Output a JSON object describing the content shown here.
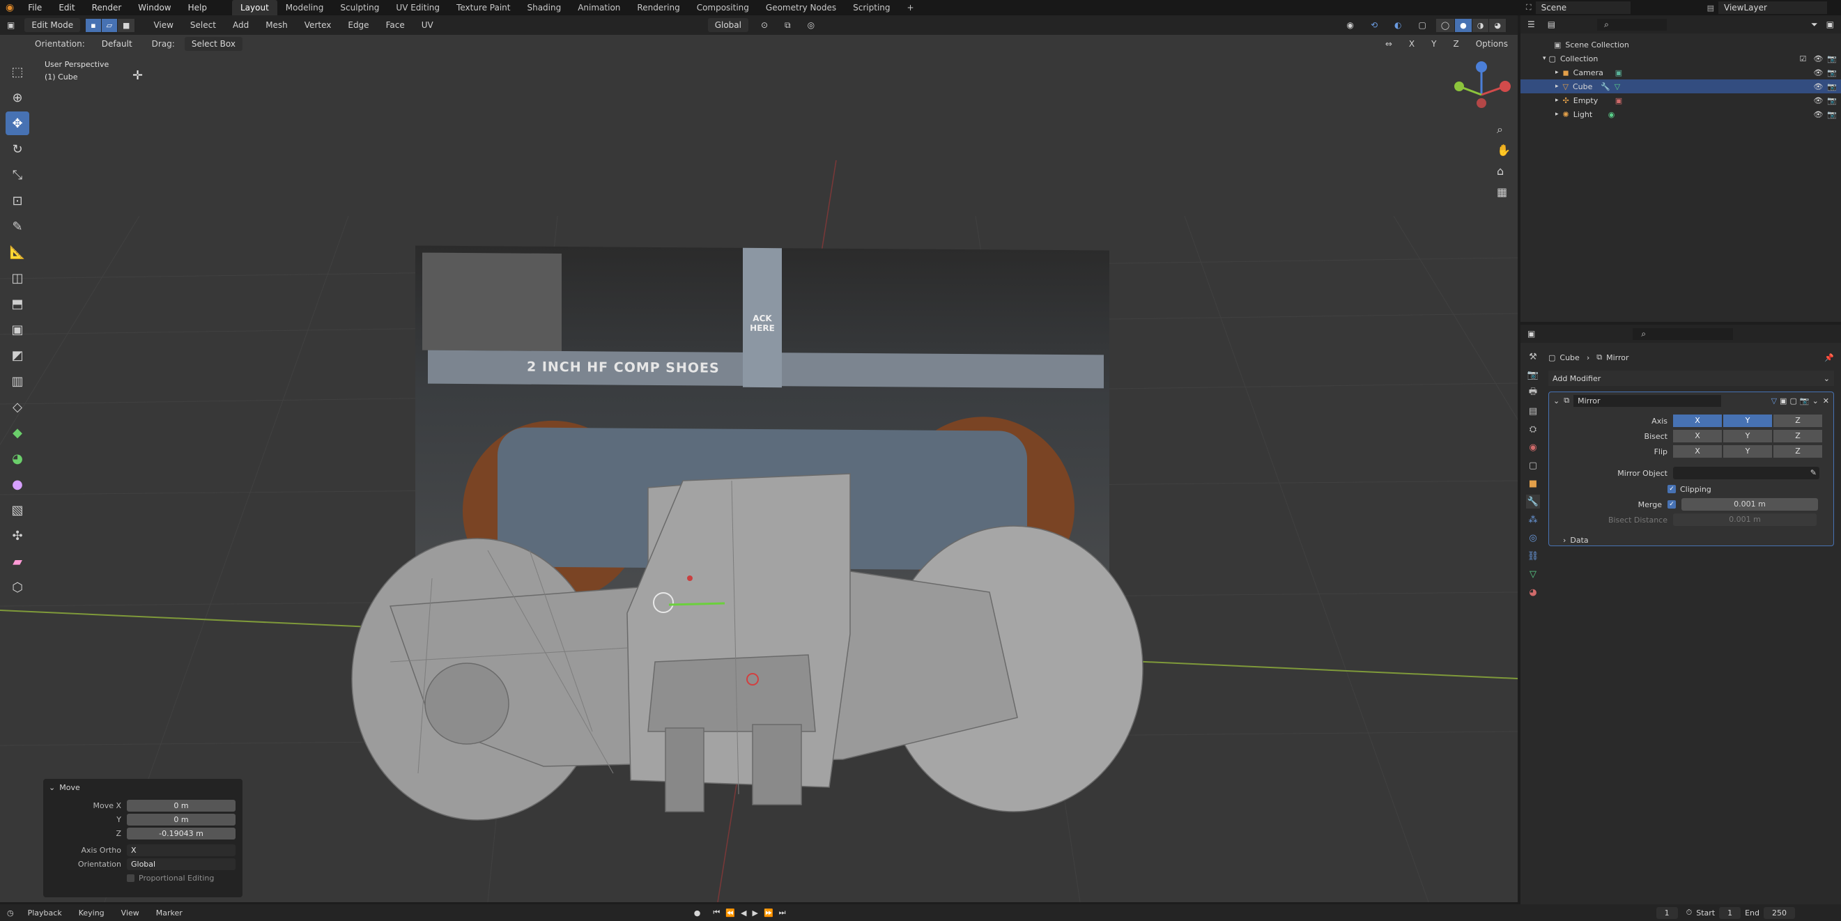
{
  "menubar": {
    "menus": [
      "File",
      "Edit",
      "Render",
      "Window",
      "Help"
    ],
    "workspaces": [
      "Layout",
      "Modeling",
      "Sculpting",
      "UV Editing",
      "Texture Paint",
      "Shading",
      "Animation",
      "Rendering",
      "Compositing",
      "Geometry Nodes",
      "Scripting"
    ],
    "active_workspace": "Layout",
    "add_tab": "+",
    "scene": "Scene",
    "view_layer": "ViewLayer"
  },
  "header": {
    "mode": "Edit Mode",
    "menus": [
      "View",
      "Select",
      "Add",
      "Mesh",
      "Vertex",
      "Edge",
      "Face",
      "UV"
    ],
    "transform_orientation": "Global"
  },
  "toolsettings": {
    "orientation_label": "Orientation:",
    "orientation_value": "Default",
    "drag_label": "Drag:",
    "drag_value": "Select Box",
    "xyz": [
      "X",
      "Y",
      "Z"
    ],
    "options": "Options"
  },
  "viewport": {
    "view_name": "User Perspective",
    "object_label": "(1) Cube",
    "reference_text_1": "ACK HERE",
    "reference_text_2": "2 INCH HF COMP SHOES"
  },
  "move_panel": {
    "title": "Move",
    "fields": [
      {
        "label": "Move X",
        "value": "0 m"
      },
      {
        "label": "Y",
        "value": "0 m"
      },
      {
        "label": "Z",
        "value": "-0.19043 m"
      }
    ],
    "axis_ortho_label": "Axis Ortho",
    "axis_ortho_value": "X",
    "orientation_label": "Orientation",
    "orientation_value": "Global",
    "proportional": "Proportional Editing"
  },
  "outliner": {
    "root": "Scene Collection",
    "collection": "Collection",
    "items": [
      "Camera",
      "Cube",
      "Empty",
      "Light"
    ],
    "selected": "Cube"
  },
  "properties": {
    "breadcrumb_object": "Cube",
    "breadcrumb_modifier": "Mirror",
    "add_modifier": "Add Modifier",
    "modifier_name": "Mirror",
    "axis_label": "Axis",
    "bisect_label": "Bisect",
    "flip_label": "Flip",
    "axes": [
      "X",
      "Y",
      "Z"
    ],
    "mirror_object_label": "Mirror Object",
    "clipping_label": "Clipping",
    "merge_label": "Merge",
    "merge_value": "0.001 m",
    "bisect_distance_label": "Bisect Distance",
    "bisect_distance_value": "0.001 m",
    "data_label": "Data"
  },
  "timeline": {
    "menus": [
      "Playback",
      "Keying",
      "View",
      "Marker"
    ],
    "current_frame": "1",
    "start_label": "Start",
    "start_value": "1",
    "end_label": "End",
    "end_value": "250"
  },
  "colors": {
    "accent": "#4772b3",
    "viewport_bg": "#383838",
    "panel_bg": "#2a2a2a",
    "x_axis": "#9a3a3a",
    "y_axis": "#8cab3c"
  }
}
